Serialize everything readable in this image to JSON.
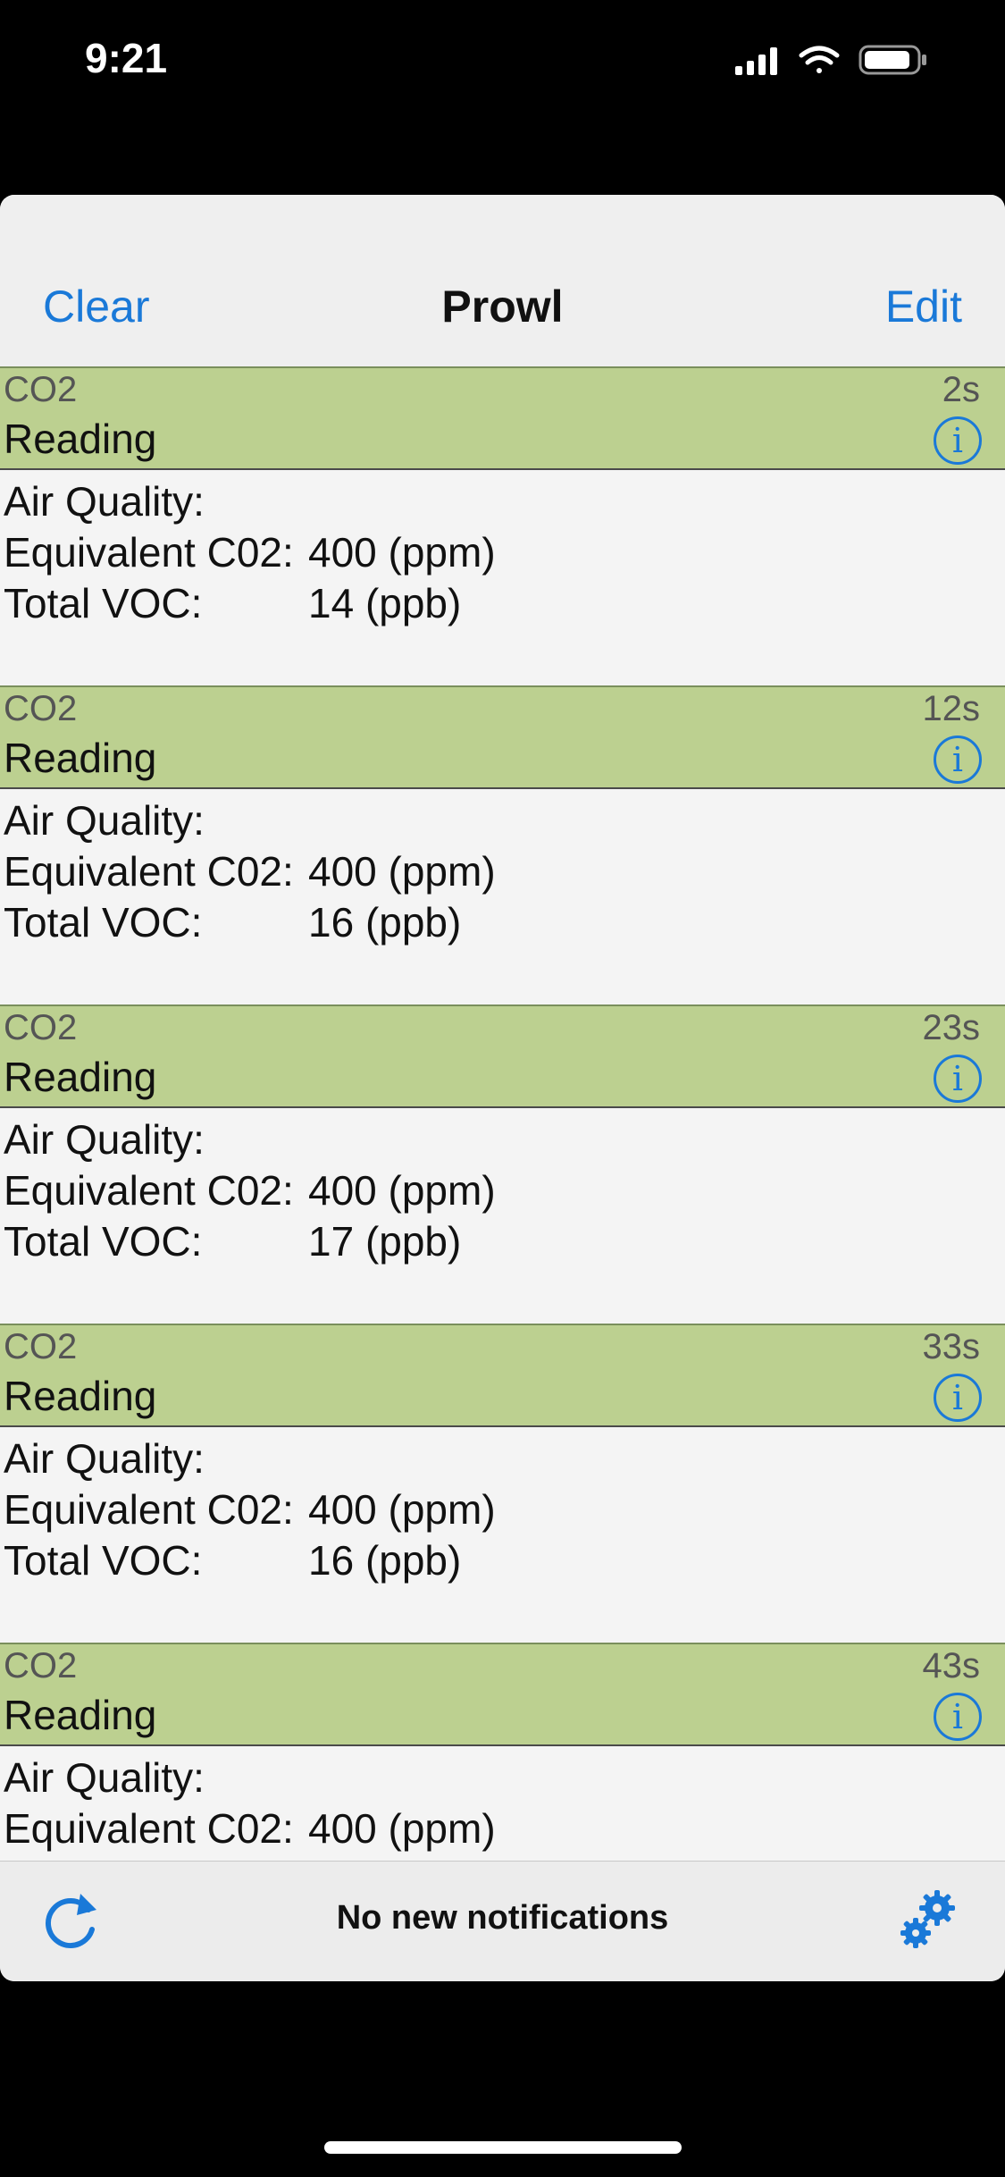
{
  "status_bar": {
    "time": "9:21"
  },
  "nav": {
    "left_label": "Clear",
    "title": "Prowl",
    "right_label": "Edit"
  },
  "notifications": [
    {
      "app": "CO2",
      "time": "2s",
      "title": "Reading",
      "line1": "Air Quality:",
      "line2_label": "Equivalent C02:",
      "line2_value": "400 (ppm)",
      "line3_label": "Total VOC:",
      "line3_value": "14 (ppb)"
    },
    {
      "app": "CO2",
      "time": "12s",
      "title": "Reading",
      "line1": "Air Quality:",
      "line2_label": "Equivalent C02:",
      "line2_value": "400 (ppm)",
      "line3_label": "Total VOC:",
      "line3_value": "16 (ppb)"
    },
    {
      "app": "CO2",
      "time": "23s",
      "title": "Reading",
      "line1": "Air Quality:",
      "line2_label": "Equivalent C02:",
      "line2_value": "400 (ppm)",
      "line3_label": "Total VOC:",
      "line3_value": "17 (ppb)"
    },
    {
      "app": "CO2",
      "time": "33s",
      "title": "Reading",
      "line1": "Air Quality:",
      "line2_label": "Equivalent C02:",
      "line2_value": "400 (ppm)",
      "line3_label": "Total VOC:",
      "line3_value": "16 (ppb)"
    },
    {
      "app": "CO2",
      "time": "43s",
      "title": "Reading",
      "line1": "Air Quality:",
      "line2_label": "Equivalent C02:",
      "line2_value": "400 (ppm)"
    }
  ],
  "info_glyph": "i",
  "bottom_bar": {
    "status_text": "No new notifications",
    "refresh_icon": "refresh-icon",
    "settings_icon": "gears-icon"
  },
  "colors": {
    "accent": "#1a79d8",
    "header_bg": "#bcd090",
    "sheet_bg": "#f4f4f4"
  }
}
